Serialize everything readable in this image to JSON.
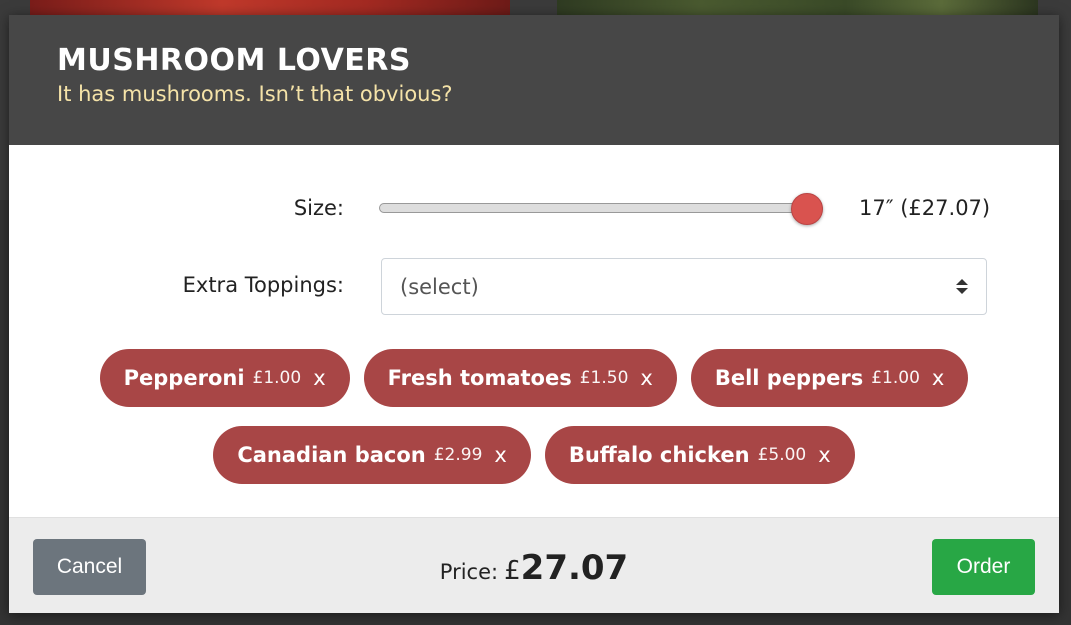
{
  "modal": {
    "title": "MUSHROOM LOVERS",
    "subtitle": "It has mushrooms. Isn’t that obvious?"
  },
  "size": {
    "label": "Size:",
    "value_text": "17″ (£27.07)",
    "slider_position": 1.0
  },
  "toppings": {
    "label": "Extra Toppings:",
    "select_value": "(select)",
    "selected": [
      {
        "name": "Pepperoni",
        "price": "£1.00",
        "remove": "x"
      },
      {
        "name": "Fresh tomatoes",
        "price": "£1.50",
        "remove": "x"
      },
      {
        "name": "Bell peppers",
        "price": "£1.00",
        "remove": "x"
      },
      {
        "name": "Canadian bacon",
        "price": "£2.99",
        "remove": "x"
      },
      {
        "name": "Buffalo chicken",
        "price": "£5.00",
        "remove": "x"
      }
    ]
  },
  "footer": {
    "cancel_label": "Cancel",
    "order_label": "Order",
    "price_label": "Price:",
    "currency": "£",
    "price_amount": "27.07"
  },
  "colors": {
    "header_bg": "#474747",
    "subtitle": "#f5e3a8",
    "chip_bg": "#a84646",
    "slider_thumb": "#d9534f",
    "cancel_bg": "#6c757d",
    "order_bg": "#28a745"
  }
}
